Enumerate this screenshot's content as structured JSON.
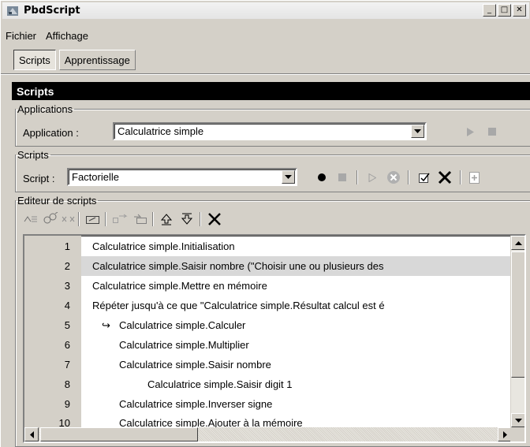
{
  "window": {
    "title": "PbdScript",
    "min_glyph": "_",
    "max_glyph": "□",
    "close_glyph": "✕"
  },
  "menu": [
    "Fichier",
    "Affichage"
  ],
  "tabs": [
    {
      "label": "Scripts",
      "active": true
    },
    {
      "label": "Apprentissage",
      "active": false
    }
  ],
  "panel": {
    "title": "Scripts"
  },
  "applications": {
    "legend": "Applications",
    "label": "Application :",
    "value": "Calculatrice simple"
  },
  "scripts": {
    "legend": "Scripts",
    "label": "Script :",
    "value": "Factorielle"
  },
  "editor": {
    "legend": "Editeur de scripts",
    "lines": [
      {
        "num": "1",
        "text": "Calculatrice simple.Initialisation",
        "indent": 0,
        "selected": false,
        "marker": ""
      },
      {
        "num": "2",
        "text": "Calculatrice simple.Saisir nombre (\"Choisir une ou plusieurs des",
        "indent": 0,
        "selected": true,
        "marker": ""
      },
      {
        "num": "3",
        "text": "Calculatrice simple.Mettre en mémoire",
        "indent": 0,
        "selected": false,
        "marker": ""
      },
      {
        "num": "4",
        "text": "Répéter jusqu'à ce que \"Calculatrice simple.Résultat calcul est é",
        "indent": 0,
        "selected": false,
        "marker": ""
      },
      {
        "num": "5",
        "text": "Calculatrice simple.Calculer",
        "indent": 1,
        "selected": false,
        "marker": "↪"
      },
      {
        "num": "6",
        "text": "Calculatrice simple.Multiplier",
        "indent": 1,
        "selected": false,
        "marker": ""
      },
      {
        "num": "7",
        "text": "Calculatrice simple.Saisir nombre",
        "indent": 1,
        "selected": false,
        "marker": ""
      },
      {
        "num": "8",
        "text": "Calculatrice simple.Saisir digit 1",
        "indent": 2,
        "selected": false,
        "marker": ""
      },
      {
        "num": "9",
        "text": "Calculatrice simple.Inverser signe",
        "indent": 1,
        "selected": false,
        "marker": ""
      },
      {
        "num": "10",
        "text": "Calculatrice simple.Ajouter à la mémoire",
        "indent": 1,
        "selected": false,
        "marker": ""
      }
    ]
  },
  "colors": {
    "face": "#d4d0c8",
    "selection": "#d8d8d8",
    "header": "#000000"
  }
}
